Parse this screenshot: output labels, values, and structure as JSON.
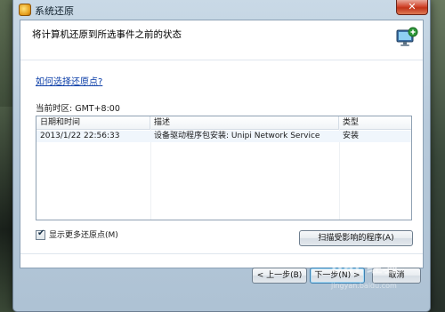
{
  "window": {
    "title": "系统还原",
    "close_symbol": "✕",
    "heading": "将计算机还原到所选事件之前的状态",
    "icon": "monitor-restore-icon"
  },
  "link_text": "如何选择还原点?",
  "timezone_label": "当前时区: GMT+8:00",
  "table": {
    "columns": [
      "日期和时间",
      "描述",
      "类型"
    ],
    "sort_indicator": "^",
    "rows": [
      {
        "date": "2013/1/22 22:56:33",
        "description": "设备驱动程序包安装: Unipi Network Service",
        "type": "安装"
      }
    ]
  },
  "show_more": {
    "label": "显示更多还原点(M)",
    "checked": true
  },
  "buttons": {
    "scan": "扫描受影响的程序(A)",
    "back": "< 上一步(B)",
    "next": "下一步(N) >",
    "cancel": "取消"
  },
  "watermark": {
    "main": "Bai 经验",
    "sub": "jingyan.baidu.com"
  }
}
